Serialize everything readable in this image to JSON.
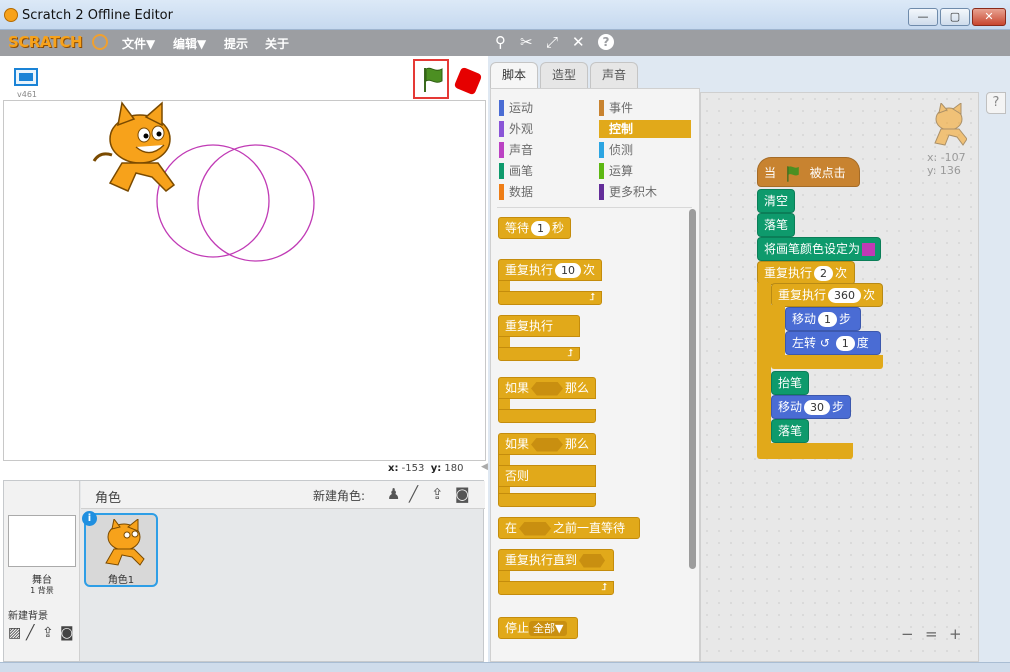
{
  "window": {
    "title": "Scratch 2 Offline Editor",
    "min_label": "—",
    "max_label": "▢",
    "close_label": "✕"
  },
  "menubar": {
    "logo": "SCRATCH",
    "items": [
      "文件▼",
      "编辑▼",
      "提示",
      "关于"
    ],
    "tool_icons": [
      "duplicate-icon",
      "delete-icon",
      "grow-icon",
      "shrink-icon",
      "help-icon"
    ]
  },
  "stage": {
    "version": "v461",
    "coords": {
      "x_label": "x:",
      "x": "-153",
      "y_label": "y:",
      "y": "180"
    }
  },
  "sprites_pane": {
    "title": "角色",
    "new_sprite_label": "新建角色:",
    "stage_label": "舞台",
    "backdrop_count": "1 背景",
    "new_backdrop_label": "新建背景",
    "sprite_name": "角色1",
    "info": "i"
  },
  "tabs": [
    "脚本",
    "造型",
    "声音"
  ],
  "categories_left": [
    {
      "label": "运动",
      "color": "#4a6cd4"
    },
    {
      "label": "外观",
      "color": "#8a55d7"
    },
    {
      "label": "声音",
      "color": "#bb42c3"
    },
    {
      "label": "画笔",
      "color": "#0e9a6c"
    },
    {
      "label": "数据",
      "color": "#ee7d16"
    }
  ],
  "categories_right": [
    {
      "label": "事件",
      "color": "#c88330"
    },
    {
      "label": "控制",
      "color": "#e1a91a",
      "active": true
    },
    {
      "label": "侦测",
      "color": "#2ca5e2"
    },
    {
      "label": "运算",
      "color": "#5cb712"
    },
    {
      "label": "更多积木",
      "color": "#632d99"
    }
  ],
  "palette_blocks": {
    "wait_pre": "等待",
    "wait_val": "1",
    "wait_post": "秒",
    "repeat_pre": "重复执行",
    "repeat_val": "10",
    "repeat_post": "次",
    "forever": "重复执行",
    "if_pre": "如果",
    "if_post": "那么",
    "ifelse_pre": "如果",
    "ifelse_post": "那么",
    "else": "否则",
    "wait_until_pre": "在",
    "wait_until_post": "之前一直等待",
    "repeat_until": "重复执行直到",
    "stop_pre": "停止",
    "stop_val": "全部▼"
  },
  "script": {
    "sprite_x": "x: -107",
    "sprite_y": "y: 136",
    "hat_pre": "当",
    "hat_post": "被点击",
    "clear": "清空",
    "pen_down_1": "落笔",
    "set_pen_color": "将画笔颜色设定为",
    "repeat_outer_pre": "重复执行",
    "repeat_outer_val": "2",
    "repeat_outer_post": "次",
    "repeat_inner_pre": "重复执行",
    "repeat_inner_val": "360",
    "repeat_inner_post": "次",
    "move1_pre": "移动",
    "move1_val": "1",
    "move1_post": "步",
    "turn_pre": "左转",
    "turn_val": "1",
    "turn_post": "度",
    "pen_up": "抬笔",
    "move2_pre": "移动",
    "move2_val": "30",
    "move2_post": "步",
    "pen_down_2": "落笔"
  },
  "zoom": {
    "out": "−",
    "reset": "=",
    "in": "+"
  },
  "help": "?"
}
